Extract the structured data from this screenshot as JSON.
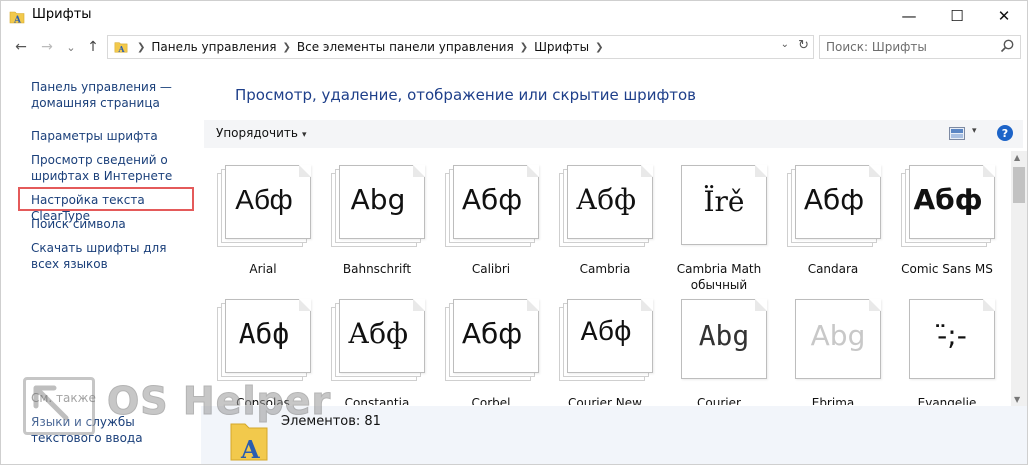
{
  "window": {
    "title": "Шрифты",
    "controls": {
      "minimize": "—",
      "maximize": "☐",
      "close": "✕"
    }
  },
  "nav": {
    "back": "←",
    "forward": "→",
    "recent": "⌄",
    "up": "↑",
    "breadcrumbs": [
      "Панель управления",
      "Все элементы панели управления",
      "Шрифты"
    ],
    "search_placeholder": "Поиск: Шрифты"
  },
  "sidebar": {
    "links": [
      "Панель управления — домашняя страница",
      "Параметры шрифта",
      "Просмотр сведений о шрифтах в Интернете",
      "Настройка текста ClearType",
      "Поиск символа",
      "Скачать шрифты для всех языков"
    ],
    "see_also": "См. также",
    "see_also_items": [
      "Языки и службы текстового ввода"
    ]
  },
  "main": {
    "heading": "Просмотр, удаление, отображение или скрытие шрифтов",
    "toolbar": {
      "sort_label": "Упорядочить",
      "help": "?"
    }
  },
  "fonts": [
    {
      "name": "Arial",
      "sample": "Абф",
      "family": "Liberation Sans",
      "weight": "normal",
      "color": "#111111",
      "stack": true
    },
    {
      "name": "Bahnschrift",
      "sample": "Abg",
      "family": "DejaVu Sans",
      "weight": "normal",
      "color": "#111111",
      "stack": true
    },
    {
      "name": "Calibri",
      "sample": "Абф",
      "family": "DejaVu Sans",
      "weight": "normal",
      "color": "#111111",
      "stack": true
    },
    {
      "name": "Cambria",
      "sample": "Абф",
      "family": "DejaVu Serif",
      "weight": "normal",
      "color": "#111111",
      "stack": true
    },
    {
      "name": "Cambria Math обычный",
      "sample": "Ïrě",
      "family": "DejaVu Serif",
      "weight": "normal",
      "color": "#111111",
      "stack": false
    },
    {
      "name": "Candara",
      "sample": "Абф",
      "family": "DejaVu Sans",
      "weight": "normal",
      "color": "#111111",
      "stack": true
    },
    {
      "name": "Comic Sans MS",
      "sample": "Абф",
      "family": "DejaVu Sans",
      "weight": "bold",
      "color": "#111111",
      "stack": true
    },
    {
      "name": "Consolas",
      "sample": "Абф",
      "family": "DejaVu Sans Mono",
      "weight": "normal",
      "color": "#111111",
      "stack": true
    },
    {
      "name": "Constantia",
      "sample": "Абф",
      "family": "DejaVu Serif",
      "weight": "normal",
      "color": "#111111",
      "stack": true
    },
    {
      "name": "Corbel",
      "sample": "Абф",
      "family": "DejaVu Sans",
      "weight": "normal",
      "color": "#111111",
      "stack": true
    },
    {
      "name": "Courier New",
      "sample": "Абф",
      "family": "Liberation Mono",
      "weight": "normal",
      "color": "#111111",
      "stack": true
    },
    {
      "name": "Courier",
      "sample": "Abg",
      "family": "DejaVu Sans Mono",
      "weight": "normal",
      "color": "#333333",
      "stack": false
    },
    {
      "name": "Ebrima",
      "sample": "Abg",
      "family": "DejaVu Sans",
      "weight": "normal",
      "color": "#c8c8c8",
      "stack": false
    },
    {
      "name": "Evangelie",
      "sample": "-̈;-",
      "family": "DejaVu Sans",
      "weight": "normal",
      "color": "#111111",
      "stack": false
    }
  ],
  "details": {
    "count": "Элементов: 81"
  },
  "watermark": {
    "text": "OS Helper"
  },
  "colors": {
    "link": "#1a3f7a",
    "heading": "#1e3f8a",
    "highlight": "#e45a5a",
    "help": "#1d64c8"
  }
}
